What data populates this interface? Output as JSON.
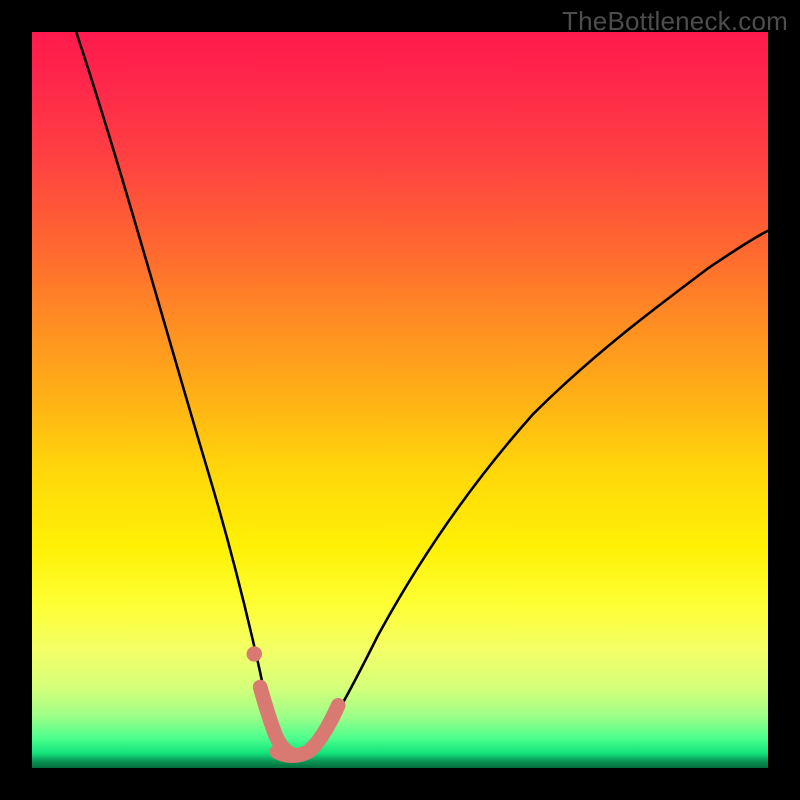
{
  "watermark": "TheBottleneck.com",
  "chart_data": {
    "type": "line",
    "title": "",
    "xlabel": "",
    "ylabel": "",
    "xlim": [
      0,
      100
    ],
    "ylim": [
      0,
      100
    ],
    "series": [
      {
        "name": "bottleneck-curve",
        "x": [
          6,
          8,
          10,
          12,
          14,
          16,
          18,
          20,
          22,
          24,
          26,
          28,
          30,
          31,
          32,
          33,
          34,
          35,
          36,
          37,
          38,
          40,
          44,
          48,
          52,
          56,
          60,
          64,
          68,
          72,
          76,
          80,
          84,
          88,
          92,
          96,
          100
        ],
        "y": [
          100,
          93,
          86,
          79,
          72,
          65,
          58,
          51,
          44,
          37,
          30,
          23,
          16,
          12,
          8,
          5,
          3,
          2,
          2,
          2,
          3,
          6,
          12,
          19,
          26,
          32,
          38,
          43,
          48,
          52,
          56,
          60,
          63,
          66,
          69,
          71,
          73
        ]
      }
    ],
    "markers": [
      {
        "name": "left-dot",
        "x": 31.0,
        "y": 12.5,
        "r": 1.1
      },
      {
        "name": "valley-blob",
        "x": 35.0,
        "y": 2.0,
        "r": 1.5
      }
    ],
    "gradient_stops_pct": {
      "red": 0,
      "orange": 40,
      "yellow": 70,
      "green": 96,
      "dark": 100
    }
  }
}
